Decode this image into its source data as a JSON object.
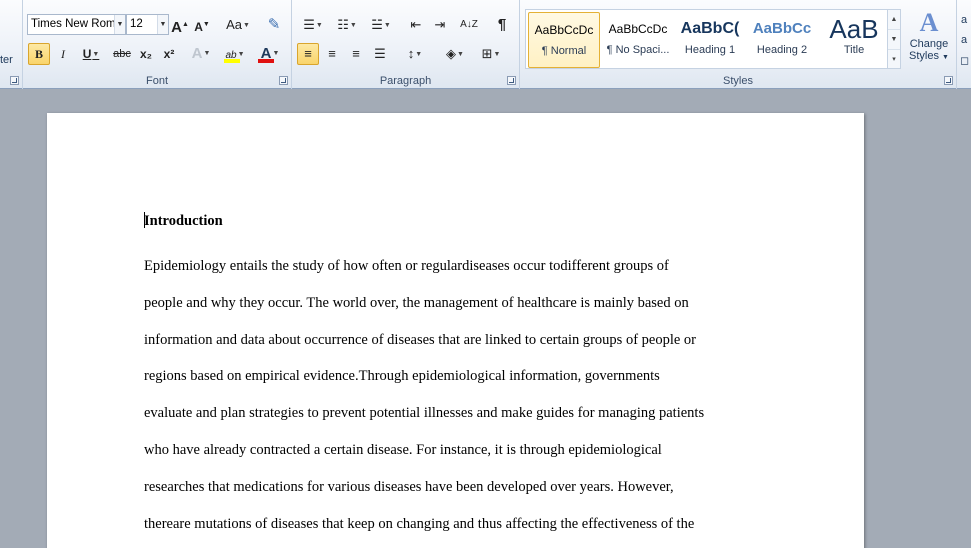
{
  "clipboard": {
    "label_fragment": "ter"
  },
  "font_group": {
    "label": "Font",
    "font_name": "Times New Rom",
    "font_size": "12",
    "grow_label": "A",
    "shrink_label": "A",
    "case_label": "Aa",
    "bold": "B",
    "italic": "I",
    "underline": "U",
    "strike": "abc",
    "subscript": "x₂",
    "superscript": "x²",
    "effects": "A",
    "highlight": "ab",
    "font_color": "A"
  },
  "paragraph_group": {
    "label": "Paragraph",
    "pilcrow": "¶",
    "sort": "A↓Z"
  },
  "styles_group": {
    "label": "Styles",
    "items": [
      {
        "sample": "AaBbCcDc",
        "name": "¶ Normal"
      },
      {
        "sample": "AaBbCcDc",
        "name": "¶ No Spaci..."
      },
      {
        "sample": "AaBbC(",
        "name": "Heading 1"
      },
      {
        "sample": "AaBbCc",
        "name": "Heading 2"
      },
      {
        "sample": "AaB",
        "name": "Title"
      }
    ],
    "change_styles_line1": "Change",
    "change_styles_line2": "Styles",
    "change_styles_icon": "A"
  },
  "colors": {
    "highlight_bar": "#ffff00",
    "font_color_bar": "#e01010",
    "active_button": "#f9d46b",
    "heading1_color": "#17365d",
    "heading2_color": "#4f81bd",
    "title_color": "#17365d"
  },
  "document": {
    "heading": "Introduction",
    "lines": [
      "Epidemiology entails the study of how often or regulardiseases  occur todifferent groups of",
      "people and why they occur. The world over, the management of healthcare is mainly  based on",
      "information  and data about occurrence of diseases that are linked to certain groups  of people  or",
      "regions based on empirical  evidence.Through  epidemiological  information,  governments",
      "evaluate and plan strategies to prevent potential illnesses  and make guides for managing  patients",
      "who have already contracted a certain disease. For instance, it is through epidemiological",
      "researches  that medications for various  diseases have been  developed over years.  However,",
      "thereare mutations of diseases that keep  on changing and thus affecting the effectiveness of the"
    ]
  }
}
